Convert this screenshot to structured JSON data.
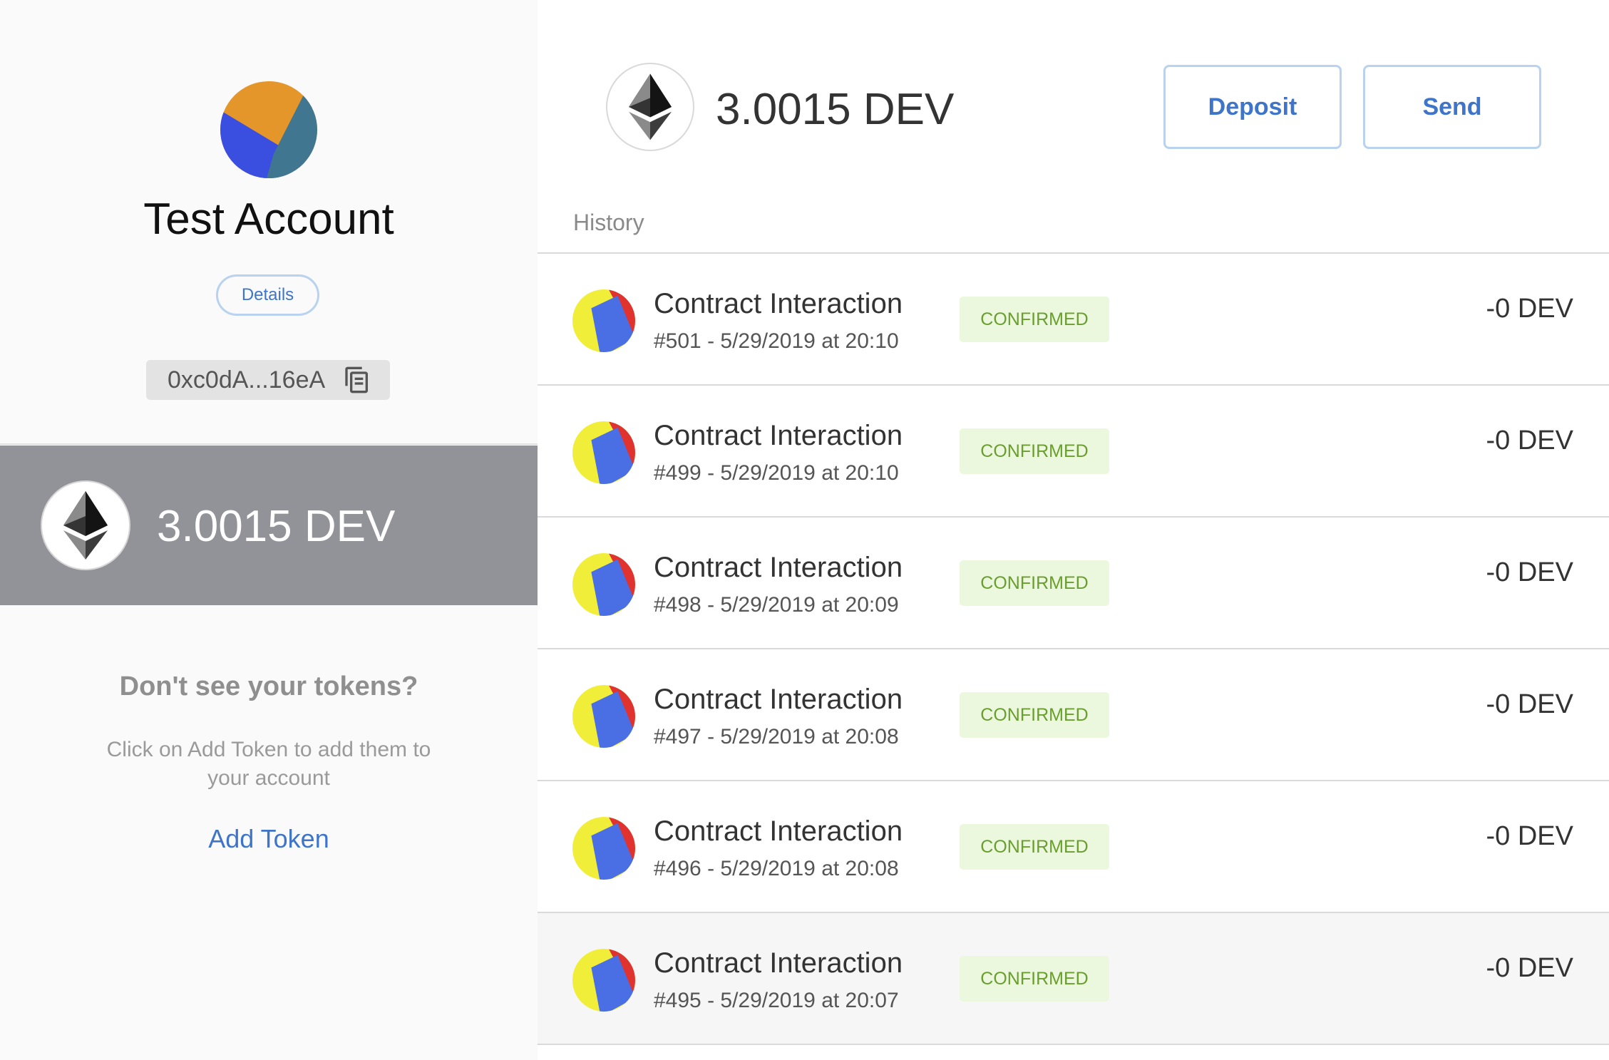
{
  "account": {
    "name": "Test Account",
    "details_label": "Details",
    "address": "0xc0dA...16eA"
  },
  "sidebar_balance": {
    "amount": "3.0015 DEV"
  },
  "tokens_hint": {
    "title": "Don't see your tokens?",
    "description": "Click on Add Token to add them to your account",
    "add_token_label": "Add Token"
  },
  "main": {
    "balance": "3.0015 DEV",
    "deposit_label": "Deposit",
    "send_label": "Send",
    "history_label": "History"
  },
  "transactions": [
    {
      "title": "Contract Interaction",
      "subtitle": "#501 - 5/29/2019 at 20:10",
      "status": "CONFIRMED",
      "amount": "-0 DEV"
    },
    {
      "title": "Contract Interaction",
      "subtitle": "#499 - 5/29/2019 at 20:10",
      "status": "CONFIRMED",
      "amount": "-0 DEV"
    },
    {
      "title": "Contract Interaction",
      "subtitle": "#498 - 5/29/2019 at 20:09",
      "status": "CONFIRMED",
      "amount": "-0 DEV"
    },
    {
      "title": "Contract Interaction",
      "subtitle": "#497 - 5/29/2019 at 20:08",
      "status": "CONFIRMED",
      "amount": "-0 DEV"
    },
    {
      "title": "Contract Interaction",
      "subtitle": "#496 - 5/29/2019 at 20:08",
      "status": "CONFIRMED",
      "amount": "-0 DEV"
    },
    {
      "title": "Contract Interaction",
      "subtitle": "#495 - 5/29/2019 at 20:07",
      "status": "CONFIRMED",
      "amount": "-0 DEV"
    }
  ],
  "colors": {
    "accent": "#3e75c9",
    "balance_bar": "#929399",
    "confirmed_bg": "#ecf8de",
    "confirmed_text": "#6a9e2f"
  },
  "icons": {
    "account_avatar": "jazzicon-avatar-icon",
    "copy": "copy-icon",
    "ethereum": "ethereum-icon",
    "transaction": "jazzicon-tx-icon"
  }
}
